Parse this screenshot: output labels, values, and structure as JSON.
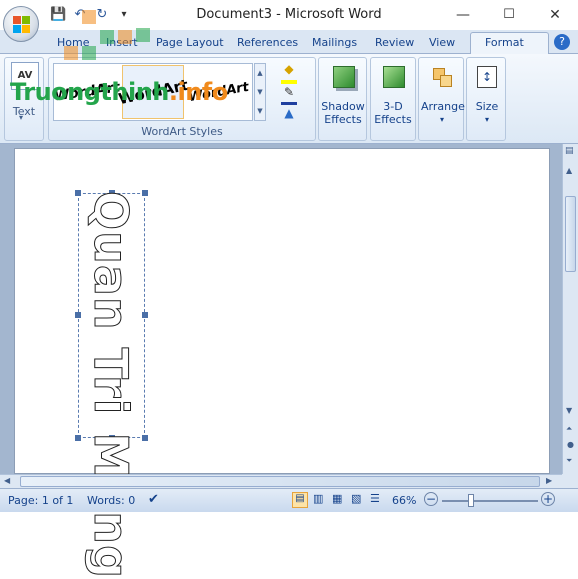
{
  "window": {
    "title": "Document3 - Microsoft Word",
    "controls": {
      "minimize": "—",
      "maximize": "☐",
      "close": "✕"
    }
  },
  "qat": {
    "save_icon": "save-icon",
    "undo_icon": "undo-icon",
    "redo_icon": "redo-icon",
    "customize": "▾"
  },
  "tabs": [
    "Home",
    "Insert",
    "Page Layout",
    "References",
    "Mailings",
    "Review",
    "View",
    "Format"
  ],
  "active_tab": "Format",
  "ribbon": {
    "text_group": {
      "icon_label": "AV",
      "label": "Text"
    },
    "wordart_styles": {
      "label": "WordArt Styles",
      "gallery": [
        "WordArt",
        "WordArt",
        "WordArt"
      ]
    },
    "shadow_effects": "Shadow Effects",
    "three_d_effects": "3-D Effects",
    "arrange": "Arrange",
    "size": "Size"
  },
  "watermark": {
    "part1": "Truongthinh",
    "part2": ".info"
  },
  "document": {
    "wordart_text": "Quan Tri Mang"
  },
  "status": {
    "page": "Page: 1 of 1",
    "words": "Words: 0",
    "zoom": "66%"
  },
  "colors": {
    "accent": "#2a6bc7",
    "tab_text": "#15428b",
    "ribbon_bg": "#dce8f5"
  }
}
